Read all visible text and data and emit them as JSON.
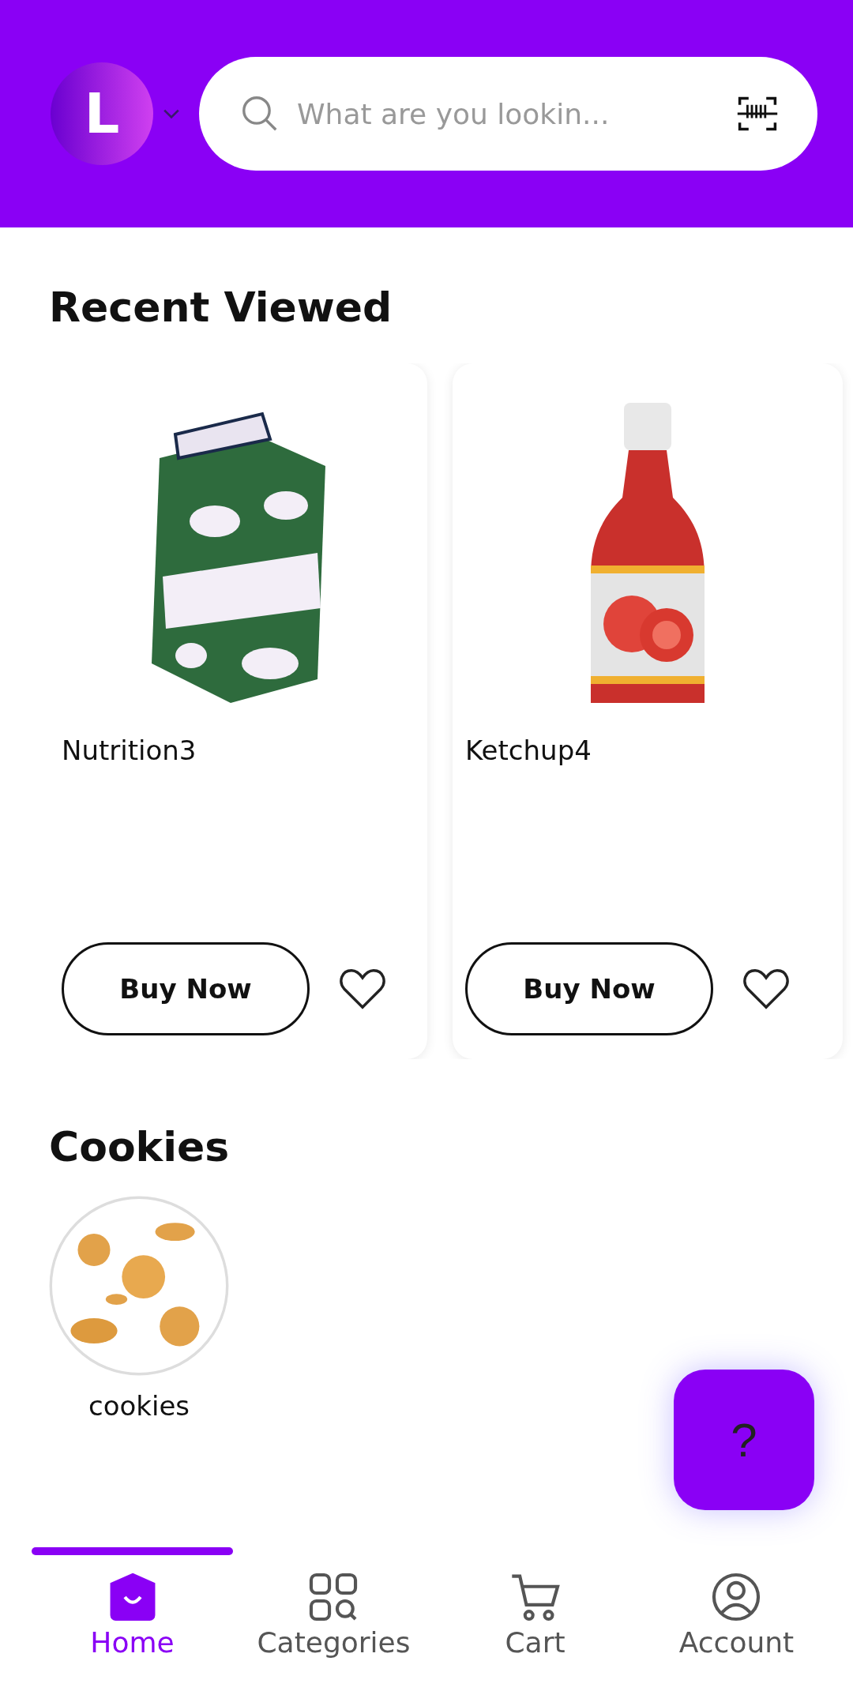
{
  "header": {
    "avatar_letter": "L",
    "search": {
      "placeholder": "What are you lookin..."
    }
  },
  "recent": {
    "title": "Recent Viewed",
    "products": [
      {
        "name": "Nutrition3",
        "kind": "carton",
        "button": "Buy Now",
        "favorite": false
      },
      {
        "name": "Ketchup4",
        "kind": "bottle",
        "button": "Buy Now",
        "favorite": false
      }
    ]
  },
  "category": {
    "title": "Cookies",
    "items": [
      {
        "label": "cookies"
      }
    ]
  },
  "help_button": {
    "label": "?"
  },
  "nav": [
    {
      "label": "Home",
      "kind": "home",
      "selected": true
    },
    {
      "label": "Categories",
      "kind": "grid",
      "selected": false
    },
    {
      "label": "Cart",
      "kind": "cart",
      "selected": false
    },
    {
      "label": "Account",
      "kind": "account",
      "selected": false
    }
  ]
}
